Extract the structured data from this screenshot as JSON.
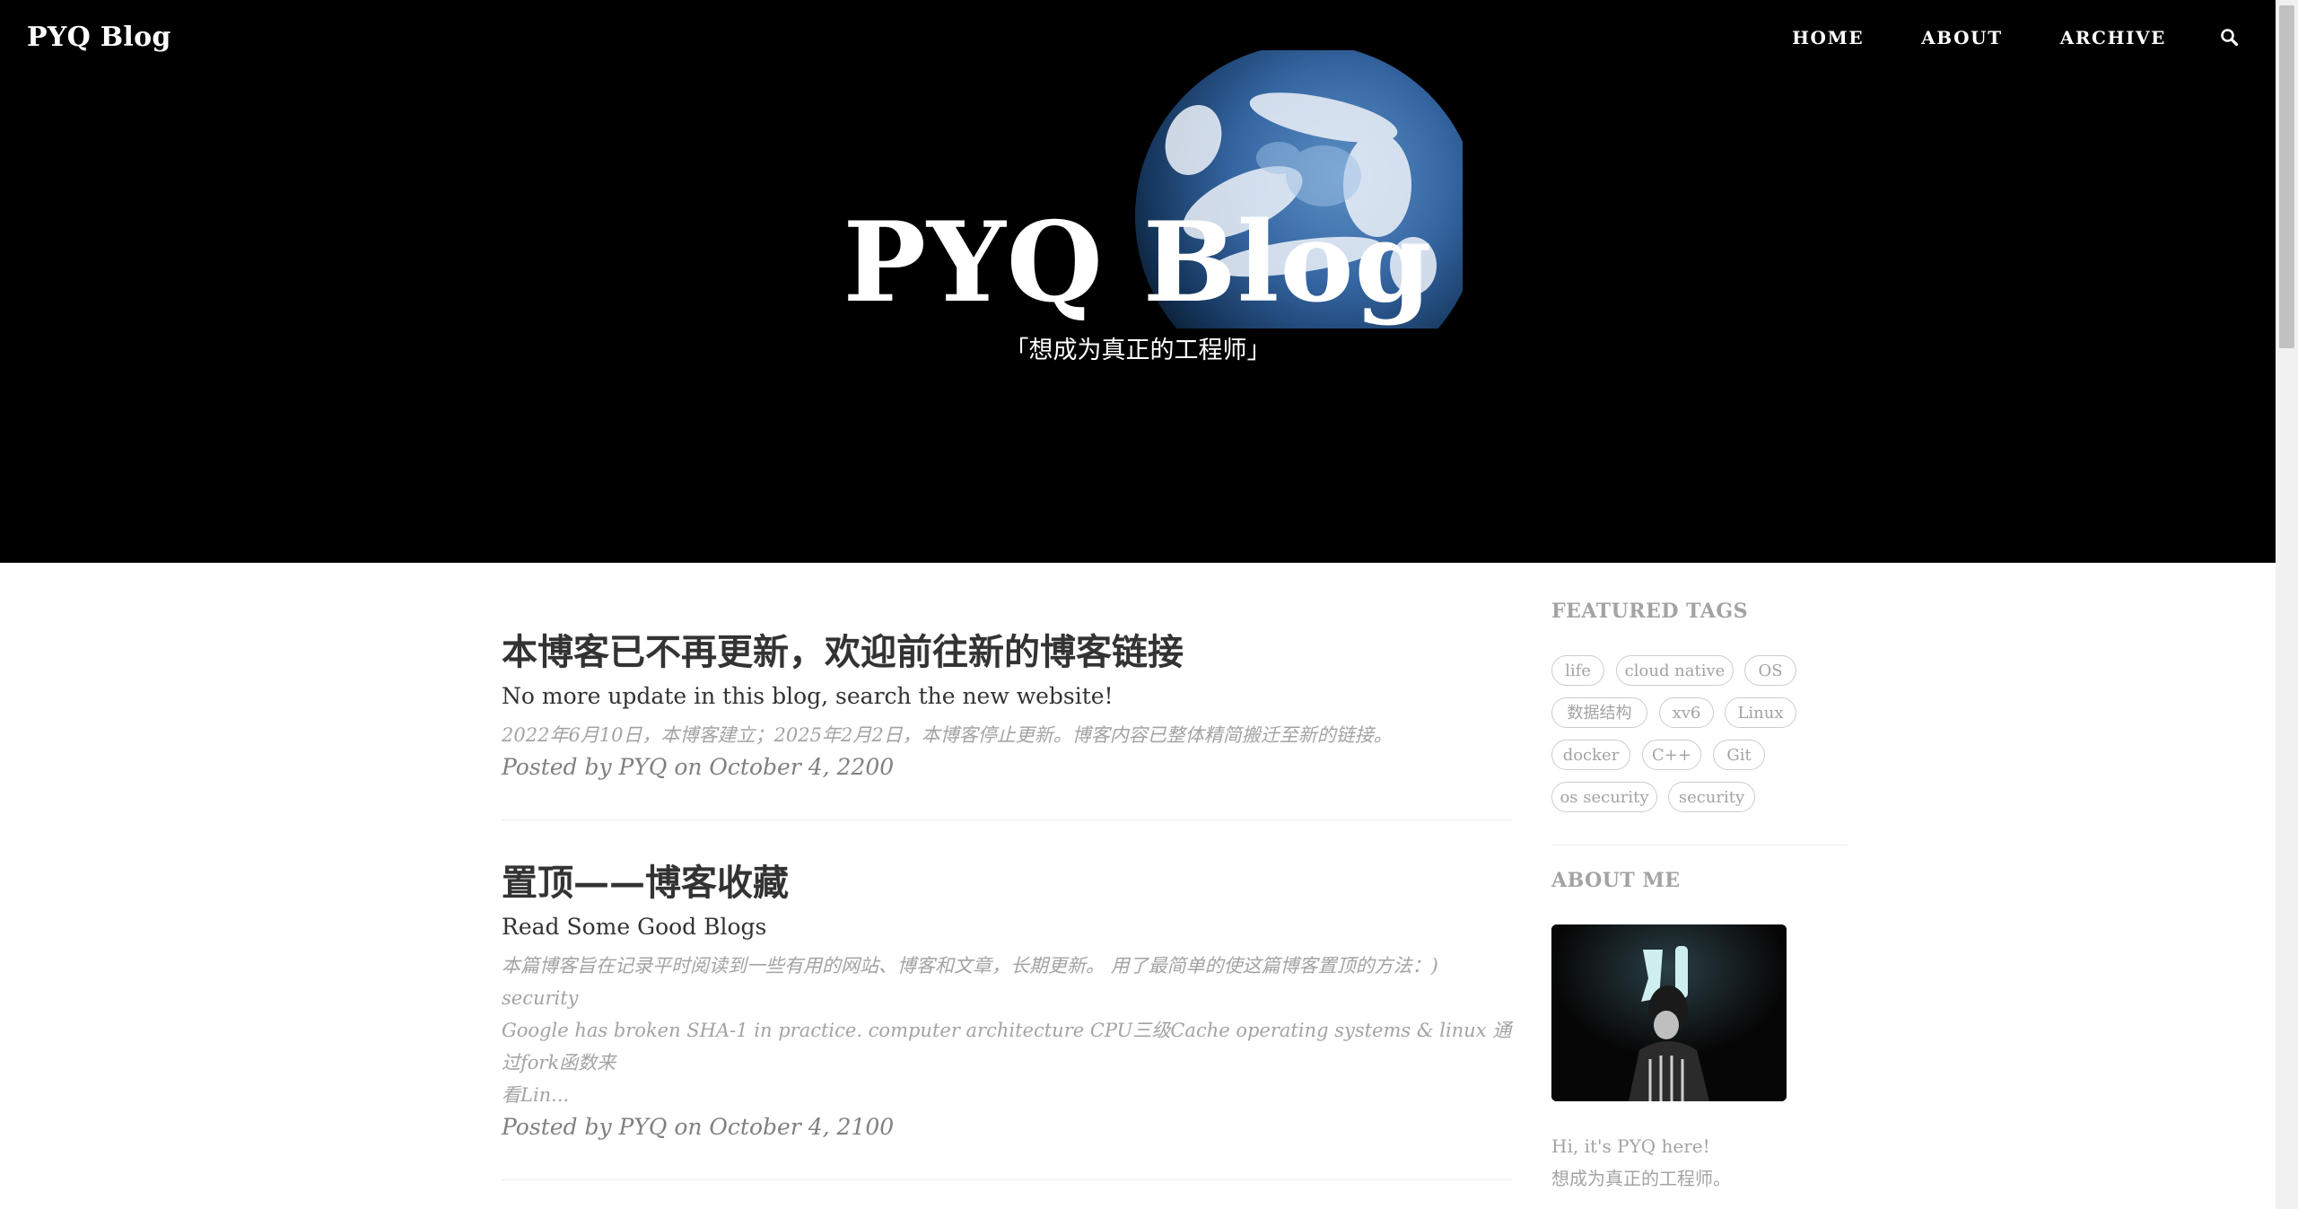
{
  "header": {
    "brand": "PYQ Blog",
    "nav": [
      "HOME",
      "ABOUT",
      "ARCHIVE"
    ],
    "search_icon": "search-icon",
    "title": "PYQ Blog",
    "subtitle": "「想成为真正的工程师」"
  },
  "posts": [
    {
      "title": "本博客已不再更新，欢迎前往新的博客链接",
      "subtitle": "No more update in this blog, search the new website!",
      "excerpt": "2022年6月10日，本博客建立；2025年2月2日，本博客停止更新。博客内容已整体精简搬迁至新的链接。",
      "meta": "Posted by PYQ on October 4, 2200"
    },
    {
      "title": "置顶——博客收藏",
      "subtitle": "Read Some Good Blogs",
      "excerpt_line1": "本篇博客旨在记录平时阅读到一些有用的网站、博客和文章，长期更新。 用了最简单的使这篇博客置顶的方法：) security",
      "excerpt_line2": "Google has broken SHA-1 in practice. computer architecture CPU三级Cache operating systems & linux 通过fork函数来",
      "excerpt_line3": "看Lin...",
      "meta": "Posted by PYQ on October 4, 2100"
    }
  ],
  "sidebar": {
    "featured_tags_heading": "FEATURED TAGS",
    "tags": [
      "life",
      "cloud native",
      "OS",
      "数据结构",
      "xv6",
      "Linux",
      "docker",
      "C++",
      "Git",
      "os security",
      "security"
    ],
    "about_heading": "ABOUT ME",
    "about_line1": "Hi, it's PYQ here!",
    "about_line2": "想成为真正的工程师。"
  },
  "colors": {
    "hero_bg": "#000000",
    "text": "#333333",
    "muted": "#a3a3a3",
    "meta": "#808080",
    "border": "#cccccc"
  }
}
